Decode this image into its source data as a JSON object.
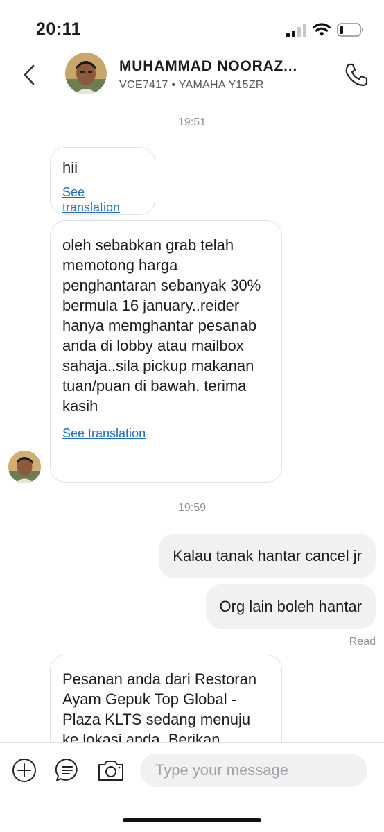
{
  "status_bar": {
    "time": "20:11",
    "icons": [
      "signal-icon",
      "wifi-icon",
      "battery-icon"
    ]
  },
  "header": {
    "contact_name": "MUHAMMAD NOORAZ...",
    "vehicle_info": "VCE7417 • YAMAHA Y15ZR",
    "icons": [
      "back-chevron-icon",
      "avatar",
      "phone-icon"
    ]
  },
  "conversation": {
    "timestamp_1": "19:51",
    "timestamp_2": "19:59",
    "incoming": [
      {
        "text": "hii",
        "translation_link": "See translation"
      },
      {
        "text": "oleh sebabkan grab telah memotong harga penghantaran sebanyak 30% bermula 16 january..reider hanya memghantar pesanab anda di lobby atau mailbox sahaja..sila pickup makanan tuan/puan di bawah. terima kasih",
        "translation_link": "See translation"
      },
      {
        "text": "Pesanan anda dari Restoran Ayam Gepuk Top Global - Plaza KLTS sedang menuju ke lokasi anda. Berikan"
      }
    ],
    "outgoing": [
      {
        "text": "Kalau tanak hantar cancel jr"
      },
      {
        "text": "Org lain boleh hantar"
      }
    ],
    "read_receipt": "Read"
  },
  "composer": {
    "placeholder": "Type your message",
    "icons": [
      "add-icon",
      "quick-reply-icon",
      "camera-icon"
    ]
  },
  "colors": {
    "link": "#1e6bc4",
    "outgoing_bubble": "#f1f1f2",
    "incoming_border": "#e3e3e3",
    "meta_text": "#8e8e93"
  }
}
